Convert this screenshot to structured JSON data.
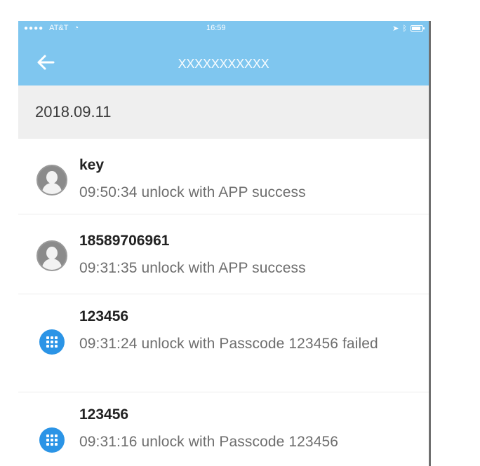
{
  "status": {
    "carrier": "AT&T",
    "time": "16:59"
  },
  "header": {
    "title": "XXXXXXXXXXX"
  },
  "date": "2018.09.11",
  "records": [
    {
      "name": "key",
      "description": "09:50:34 unlock with APP success",
      "icon": "user-avatar-icon"
    },
    {
      "name": "18589706961",
      "description": "09:31:35 unlock with APP success",
      "icon": "user-avatar-icon"
    },
    {
      "name": "123456",
      "description": "09:31:24 unlock with Passcode 123456 failed",
      "icon": "passcode-icon"
    },
    {
      "name": "123456",
      "description": "09:31:16 unlock with Passcode 123456",
      "icon": "passcode-icon"
    }
  ],
  "colors": {
    "header": "#7fc6ef",
    "date_bar": "#efefef",
    "passcode_icon": "#2b94e6"
  }
}
